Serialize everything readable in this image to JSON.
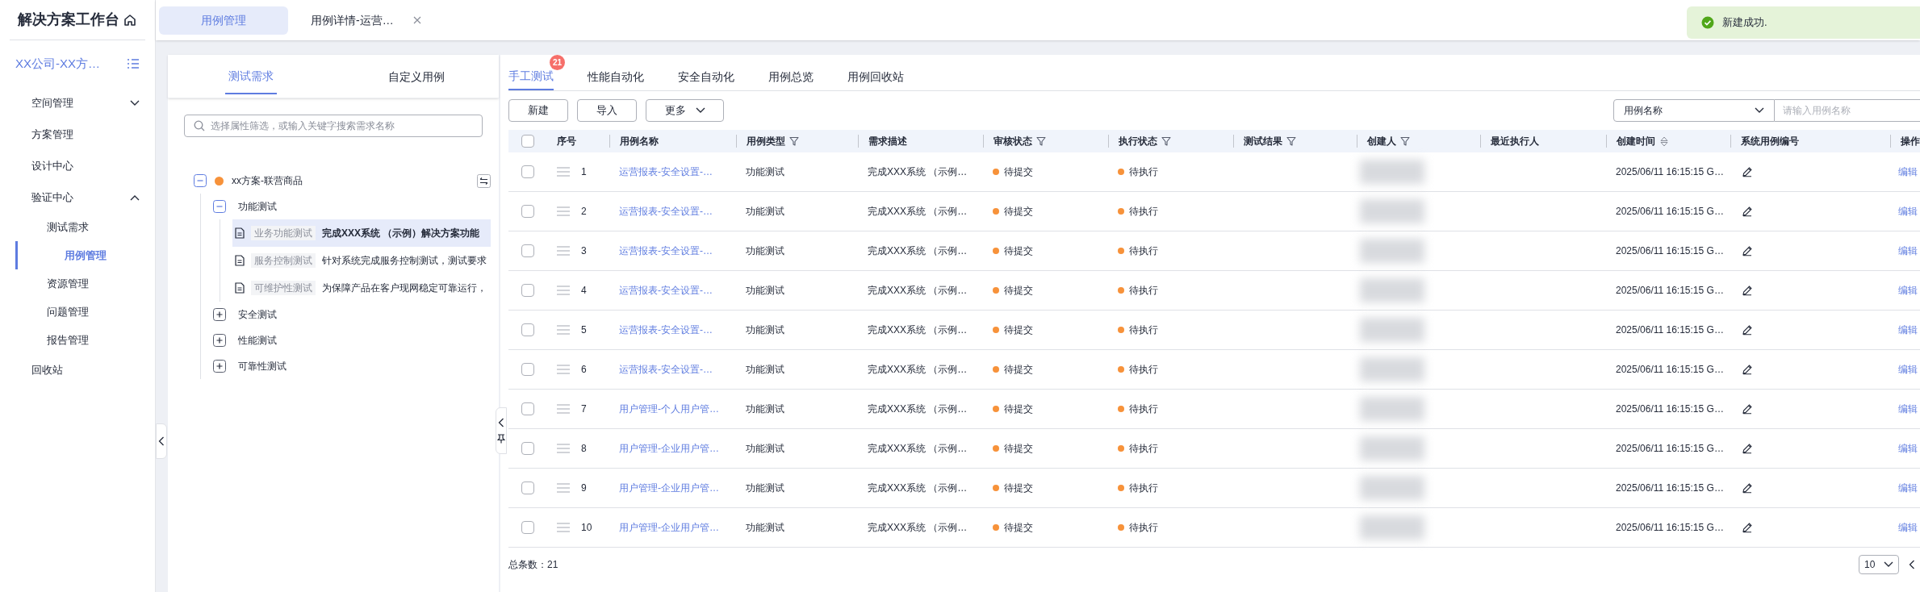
{
  "sidebar": {
    "title": "解决方案工作台",
    "project": "XX公司-XX方…",
    "items": [
      {
        "kind": "group",
        "label": "空间管理",
        "expanded": false
      },
      {
        "kind": "link",
        "label": "方案管理",
        "selected": false
      },
      {
        "kind": "link",
        "label": "设计中心",
        "selected": false
      },
      {
        "kind": "group",
        "label": "验证中心",
        "expanded": true,
        "children": [
          {
            "label": "测试需求",
            "selected": false
          },
          {
            "label": "用例管理",
            "selected": true
          },
          {
            "label": "资源管理",
            "selected": false
          },
          {
            "label": "问题管理",
            "selected": false
          },
          {
            "label": "报告管理",
            "selected": false
          }
        ]
      },
      {
        "kind": "link",
        "label": "回收站",
        "selected": false
      }
    ]
  },
  "top_tabs": [
    {
      "label": "用例管理",
      "selected": true,
      "closable": false
    },
    {
      "label": "用例详情-运营…",
      "selected": false,
      "closable": true
    }
  ],
  "toast": {
    "kind": "success",
    "text": "新建成功."
  },
  "requirement_panel": {
    "tabs": [
      {
        "label": "测试需求",
        "selected": true
      },
      {
        "label": "自定义用例",
        "selected": false
      }
    ],
    "search": {
      "placeholder": "选择属性筛选，或输入关键字搜索需求名称"
    },
    "tree": [
      {
        "label": "xx方案-联营商品",
        "color": "#f7923a",
        "expanded": true,
        "children": [
          {
            "label": "功能测试",
            "expanded": true,
            "children": [
              {
                "tag": "业务功能测试",
                "description": "完成XXX系统 （示例）解决方案功能",
                "selected": true
              },
              {
                "tag": "服务控制测试",
                "description": "针对系统完成服务控制测试，测试要求",
                "selected": false
              },
              {
                "tag": "可维护性测试",
                "description": "为保障产品在客户现网稳定可靠运行，",
                "selected": false
              }
            ]
          },
          {
            "label": "安全测试",
            "expanded": false
          },
          {
            "label": "性能测试",
            "expanded": false
          },
          {
            "label": "可靠性测试",
            "expanded": false
          }
        ]
      }
    ]
  },
  "case_panel": {
    "tabs": [
      {
        "label": "手工测试",
        "selected": true,
        "badge": "21"
      },
      {
        "label": "性能自动化",
        "selected": false
      },
      {
        "label": "安全自动化",
        "selected": false
      },
      {
        "label": "用例总览",
        "selected": false
      },
      {
        "label": "用例回收站",
        "selected": false
      }
    ],
    "buttons": [
      {
        "label": "新建",
        "dropdown": false
      },
      {
        "label": "导入",
        "dropdown": false
      },
      {
        "label": "更多",
        "dropdown": true
      }
    ],
    "search": {
      "field": "用例名称",
      "placeholder": "请输入用例名称"
    },
    "table": {
      "header_checked": false,
      "columns": [
        {
          "label": "序号"
        },
        {
          "label": "用例名称",
          "filter": false,
          "sort": false
        },
        {
          "label": "用例类型",
          "filter": true,
          "sort": false
        },
        {
          "label": "需求描述",
          "filter": false,
          "sort": false
        },
        {
          "label": "审核状态",
          "filter": true,
          "sort": false
        },
        {
          "label": "执行状态",
          "filter": true,
          "sort": false
        },
        {
          "label": "测试结果",
          "filter": true,
          "sort": false
        },
        {
          "label": "创建人",
          "filter": true,
          "sort": false
        },
        {
          "label": "最近执行人",
          "filter": false,
          "sort": false
        },
        {
          "label": "创建时间",
          "filter": false,
          "sort": true
        },
        {
          "label": "系统用例编号",
          "filter": false,
          "sort": false
        },
        {
          "label": "操作"
        }
      ],
      "rows": [
        {
          "checked": false,
          "index": "1",
          "name": "运营报表-安全设置-…",
          "type": "功能测试",
          "description": "完成XXX系统 （示例…",
          "review_status": "待提交",
          "exec_status": "待执行",
          "created": "2025/06/11 16:15:15 G…",
          "action": "编辑"
        },
        {
          "checked": false,
          "index": "2",
          "name": "运营报表-安全设置-…",
          "type": "功能测试",
          "description": "完成XXX系统 （示例…",
          "review_status": "待提交",
          "exec_status": "待执行",
          "created": "2025/06/11 16:15:15 G…",
          "action": "编辑"
        },
        {
          "checked": false,
          "index": "3",
          "name": "运营报表-安全设置-…",
          "type": "功能测试",
          "description": "完成XXX系统 （示例…",
          "review_status": "待提交",
          "exec_status": "待执行",
          "created": "2025/06/11 16:15:15 G…",
          "action": "编辑"
        },
        {
          "checked": false,
          "index": "4",
          "name": "运营报表-安全设置-…",
          "type": "功能测试",
          "description": "完成XXX系统 （示例…",
          "review_status": "待提交",
          "exec_status": "待执行",
          "created": "2025/06/11 16:15:15 G…",
          "action": "编辑"
        },
        {
          "checked": false,
          "index": "5",
          "name": "运营报表-安全设置-…",
          "type": "功能测试",
          "description": "完成XXX系统 （示例…",
          "review_status": "待提交",
          "exec_status": "待执行",
          "created": "2025/06/11 16:15:15 G…",
          "action": "编辑"
        },
        {
          "checked": false,
          "index": "6",
          "name": "运营报表-安全设置-…",
          "type": "功能测试",
          "description": "完成XXX系统 （示例…",
          "review_status": "待提交",
          "exec_status": "待执行",
          "created": "2025/06/11 16:15:15 G…",
          "action": "编辑"
        },
        {
          "checked": false,
          "index": "7",
          "name": "用户管理-个人用户管…",
          "type": "功能测试",
          "description": "完成XXX系统 （示例…",
          "review_status": "待提交",
          "exec_status": "待执行",
          "created": "2025/06/11 16:15:15 G…",
          "action": "编辑"
        },
        {
          "checked": false,
          "index": "8",
          "name": "用户管理-企业用户管…",
          "type": "功能测试",
          "description": "完成XXX系统 （示例…",
          "review_status": "待提交",
          "exec_status": "待执行",
          "created": "2025/06/11 16:15:15 G…",
          "action": "编辑"
        },
        {
          "checked": false,
          "index": "9",
          "name": "用户管理-企业用户管…",
          "type": "功能测试",
          "description": "完成XXX系统 （示例…",
          "review_status": "待提交",
          "exec_status": "待执行",
          "created": "2025/06/11 16:15:15 G…",
          "action": "编辑"
        },
        {
          "checked": false,
          "index": "10",
          "name": "用户管理-企业用户管…",
          "type": "功能测试",
          "description": "完成XXX系统 （示例…",
          "review_status": "待提交",
          "exec_status": "待执行",
          "created": "2025/06/11 16:15:15 G…",
          "action": "编辑"
        }
      ]
    },
    "footer": {
      "total": "总条数：21",
      "page_size": "10"
    }
  }
}
